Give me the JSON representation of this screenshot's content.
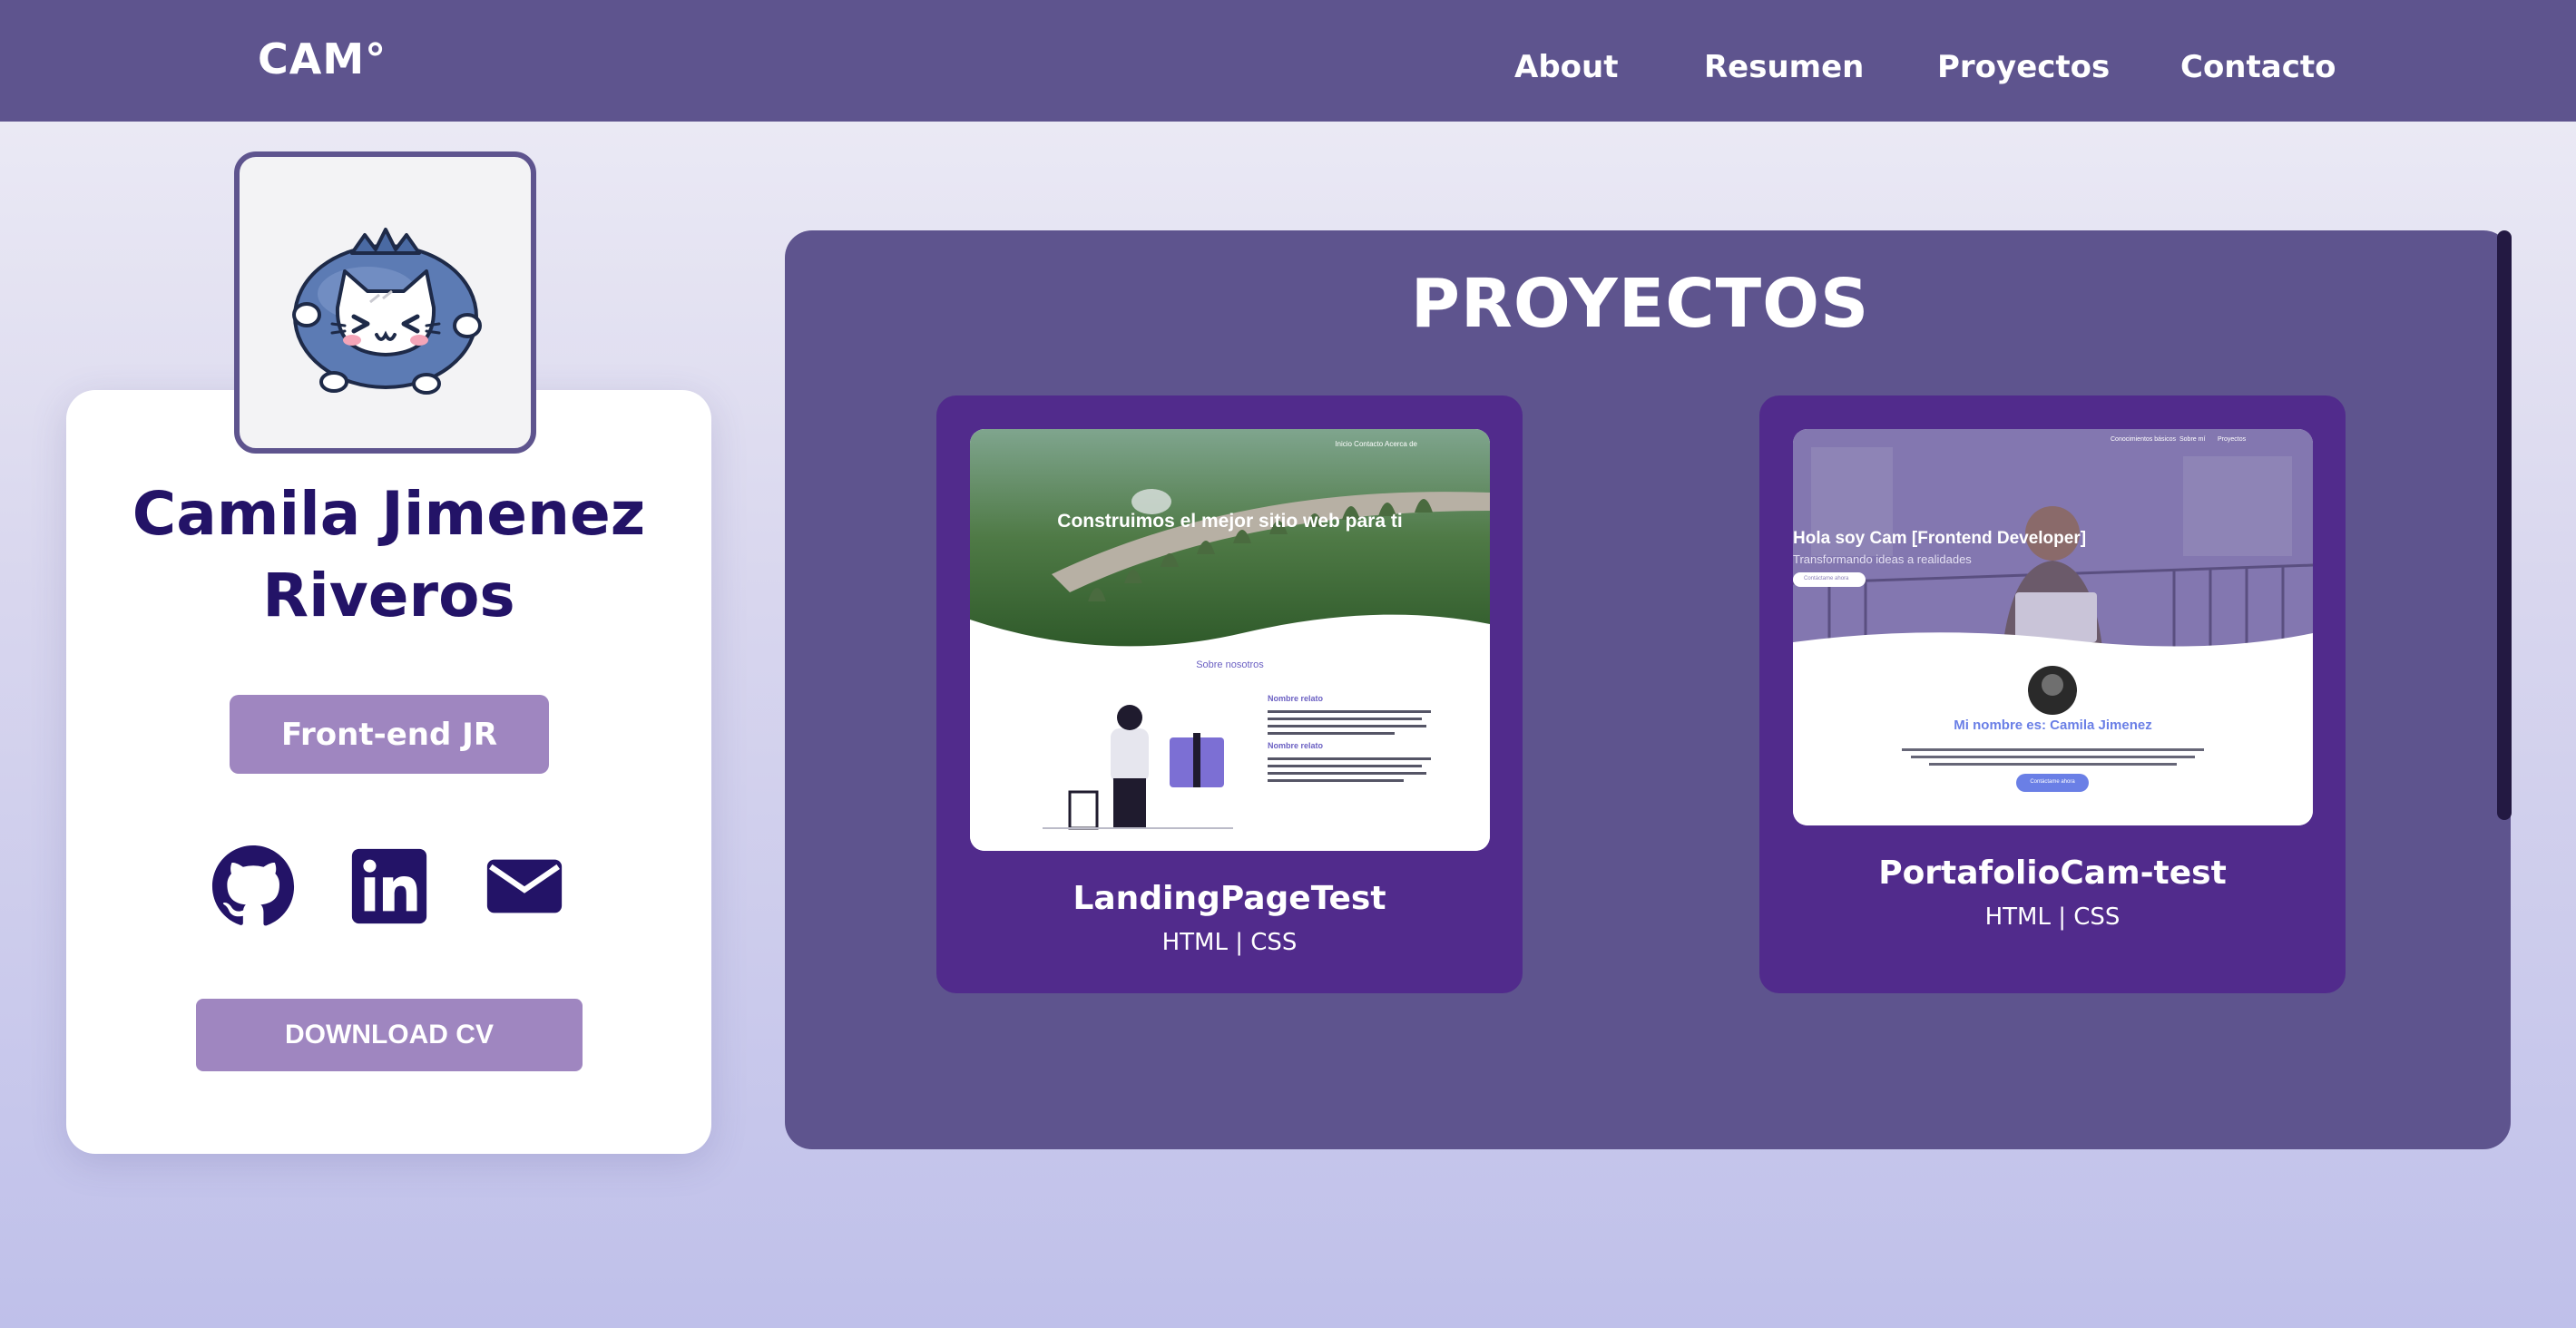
{
  "header": {
    "brand": "CAM°",
    "nav": [
      {
        "label": "About"
      },
      {
        "label": "Resumen"
      },
      {
        "label": "Proyectos"
      },
      {
        "label": "Contacto"
      }
    ]
  },
  "profile": {
    "name_line1": "Camila Jimenez",
    "name_line2": "Riveros",
    "role": "Front-end JR",
    "socials": [
      {
        "icon": "github-icon"
      },
      {
        "icon": "linkedin-icon"
      },
      {
        "icon": "mail-icon"
      }
    ],
    "download_label": "DOWNLOAD CV"
  },
  "projects": {
    "title": "PROYECTOS",
    "items": [
      {
        "name": "LandingPageTest",
        "tech": "HTML | CSS",
        "preview": {
          "nav": "Inicio   Contacto   Acerca de",
          "hero": "Construimos el mejor sitio web para ti",
          "section": "Sobre nosotros",
          "item1": "Nombre relato",
          "item2": "Nombre relato"
        }
      },
      {
        "name": "PortafolioCam-test",
        "tech": "HTML | CSS",
        "preview": {
          "nav1": "Conocimientos básicos",
          "nav2": "Sobre mí",
          "nav3": "Proyectos",
          "hero": "Hola soy Cam [Frontend Developer]",
          "sub": "Transformando ideas a realidades",
          "mini_button": "Contáctame ahora",
          "name_line": "Mi nombre es: Camila Jimenez",
          "cta": "Contáctame ahora"
        }
      }
    ]
  },
  "colors": {
    "nav_bg": "#5e548e",
    "accent": "#9f86c0",
    "card_bg": "#512b8c",
    "name_text": "#231367"
  }
}
